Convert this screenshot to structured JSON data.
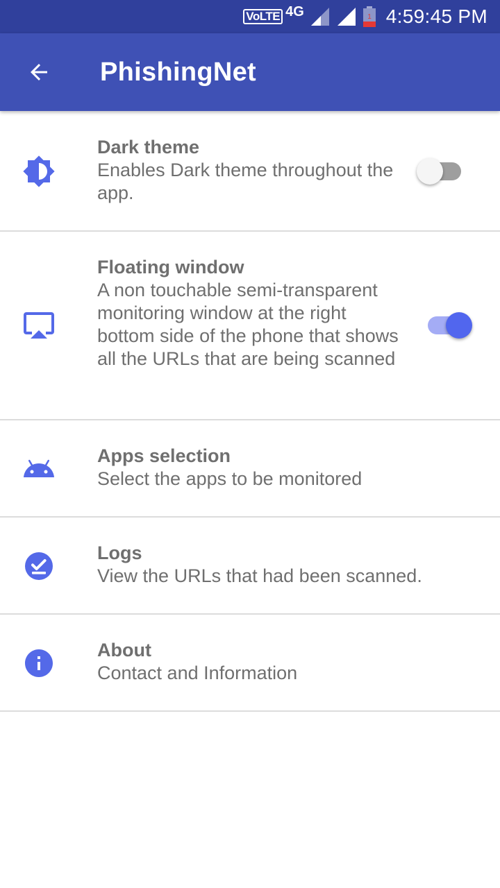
{
  "status_bar": {
    "volte": "VoLTE",
    "network": "4G",
    "time": "4:59:45 PM",
    "battery_level": "1"
  },
  "app_bar": {
    "title": "PhishingNet"
  },
  "settings": [
    {
      "title": "Dark theme",
      "summary": "Enables Dark theme throughout the app.",
      "icon": "brightness-icon",
      "toggle": false
    },
    {
      "title": "Floating window",
      "summary": "A non touchable semi-transparent monitoring window at the right bottom side of the phone that shows all the URLs that are being scanned",
      "icon": "airplay-icon",
      "toggle": true
    },
    {
      "title": "Apps selection",
      "summary": "Select the apps to be monitored",
      "icon": "android-icon"
    },
    {
      "title": "Logs",
      "summary": "View the URLs that had been scanned.",
      "icon": "check-circle-icon"
    },
    {
      "title": "About",
      "summary": "Contact and Information",
      "icon": "info-icon"
    }
  ],
  "colors": {
    "status_bar": "#30409c",
    "app_bar": "#3f51b5",
    "accent": "#5166ee",
    "icon": "#5469e8",
    "text": "#6f6f6f",
    "divider": "#dcdcdc"
  }
}
